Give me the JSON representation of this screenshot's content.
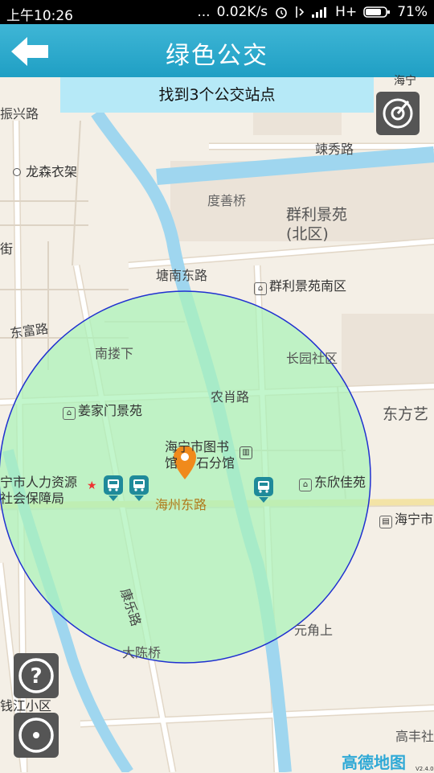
{
  "status": {
    "time": "上午10:26",
    "dots": "...",
    "speed": "0.02K/s",
    "network": "H+",
    "battery": "71%"
  },
  "header": {
    "title": "绿色公交",
    "back_icon": "back-arrow-icon"
  },
  "banner": {
    "text": "找到3个公交站点"
  },
  "map": {
    "labels": {
      "zhenxing": "振兴路",
      "haining_top": "海宁",
      "longsen": "龙森衣架",
      "ji": "街",
      "lianxiu": "竦秀路",
      "dushan": "度善桥",
      "qunli": "群利景苑",
      "beiqu": "(北区)",
      "tangnan": "塘南东路",
      "qunli_nan": "群利景苑南区",
      "dongfu": "东富路",
      "nanlou": "南搂下",
      "changyuan": "长园社区",
      "nongxiao": "农肖路",
      "dongfang": "东方艺",
      "jiangjiamen": "姜家门景苑",
      "library_1": "海宁市图书",
      "library_2": "馆",
      "library_3": "石分馆",
      "hr_1": "宁市人力资源",
      "hr_2": "社会保障局",
      "dongxin": "东欣佳苑",
      "haizhou": "海州东路",
      "haining_right": "海宁市",
      "kangle": "康乐路",
      "yuanjiao": "元角上",
      "dachen": "大陈桥",
      "qianjiang": "钱江小区",
      "gaofeng": "高丰社",
      "logo": "高德地图",
      "version": "V2.4.0"
    },
    "bus_stop_count": 3
  },
  "controls": {
    "locate_icon": "radar-locate-icon",
    "help_icon": "help-icon",
    "location_icon": "my-location-icon"
  }
}
